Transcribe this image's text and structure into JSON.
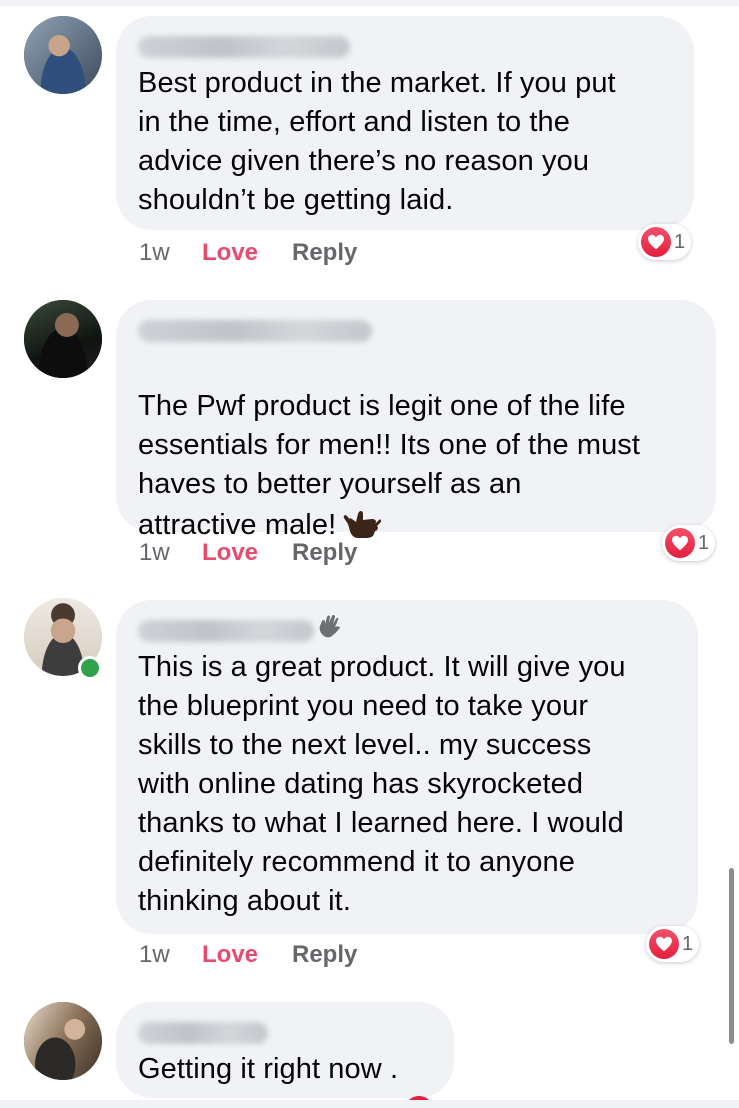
{
  "comments": [
    {
      "text": "Best product in the market. If you put\nin the time, effort and listen to the\nadvice given there’s no reason you\nshouldn’t be getting laid.",
      "time": "1w",
      "love_label": "Love",
      "reply_label": "Reply",
      "reaction_count": "1",
      "reaction_icon": "heart-icon"
    },
    {
      "text": "The Pwf product is legit one of the life\nessentials for men!! Its one of the must\nhaves to better yourself as an\nattractive male!",
      "emoji": "call-me-hand-icon",
      "time": "1w",
      "love_label": "Love",
      "reply_label": "Reply",
      "reaction_count": "1",
      "reaction_icon": "heart-icon"
    },
    {
      "text": "This is a great product. It will give you\nthe blueprint you need to take your\nskills to the next level.. my success\nwith online dating has skyrocketed\nthanks to what I learned here. I would\ndefinitely recommend it to anyone\nthinking about it.",
      "author_badge": "waving-hand-icon",
      "online": true,
      "time": "1w",
      "love_label": "Love",
      "reply_label": "Reply",
      "reaction_count": "1",
      "reaction_icon": "heart-icon"
    },
    {
      "text": "Getting it right now .",
      "reaction_icon": "heart-icon"
    }
  ],
  "colors": {
    "bubble": "#f0f2f5",
    "love": "#e94b6e",
    "meta": "#65676b",
    "heart": "#e41e3f",
    "online": "#31a24c"
  }
}
